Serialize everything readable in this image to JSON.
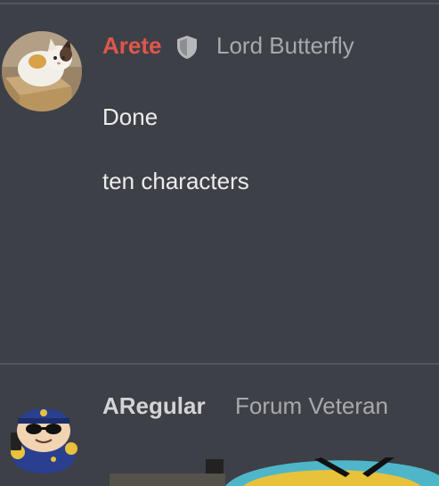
{
  "posts": [
    {
      "author": "Arete",
      "author_color": "#e0574b",
      "badge_icon": "shield-icon",
      "user_title": "Lord Butterfly",
      "avatar_icon": "cat-in-box-avatar",
      "body": [
        "Done",
        "ten characters"
      ]
    },
    {
      "author": "ARegular",
      "author_color": "#d3d4d6",
      "user_title": "Forum Veteran",
      "avatar_icon": "cartman-police-avatar",
      "embed_icon": "cartman-image-embed"
    }
  ],
  "colors": {
    "background": "#3e4047",
    "divider": "#54565d",
    "body_text": "#ececec",
    "muted_text": "#a7a9ad"
  }
}
